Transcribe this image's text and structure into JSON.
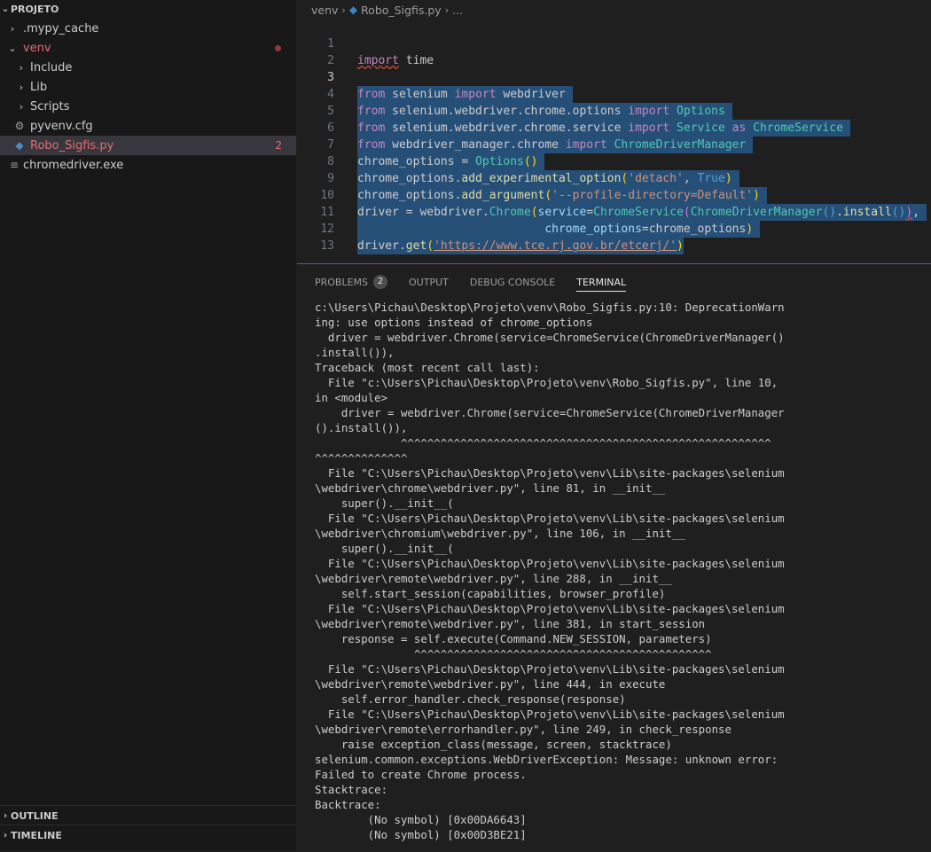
{
  "explorer": {
    "title": "PROJETO",
    "items": [
      {
        "label": ".mypy_cache"
      },
      {
        "label": "venv"
      },
      {
        "label": "Include"
      },
      {
        "label": "Lib"
      },
      {
        "label": "Scripts"
      },
      {
        "label": "pyvenv.cfg"
      },
      {
        "label": "Robo_Sigfis.py",
        "badge": "2"
      },
      {
        "label": "chromedriver.exe"
      }
    ],
    "outline_label": "OUTLINE",
    "timeline_label": "TIMELINE"
  },
  "editor": {
    "breadcrumb": [
      "venv",
      "Robo_Sigfis.py",
      "..."
    ],
    "line_numbers": [
      "1",
      "2",
      "3",
      "4",
      "5",
      "6",
      "7",
      "8",
      "9",
      "10",
      "11",
      "12",
      "13"
    ],
    "code": {
      "l1": [
        "import",
        "time"
      ],
      "l3": [
        "from",
        "selenium",
        "import",
        "webdriver"
      ],
      "l4": [
        "from",
        "selenium.webdriver.chrome.options",
        "import",
        "Options"
      ],
      "l5": [
        "from",
        "selenium.webdriver.chrome.service",
        "import",
        "Service",
        "as",
        "ChromeService"
      ],
      "l6": [
        "from",
        "webdriver_manager.chrome",
        "import",
        "ChromeDriverManager"
      ],
      "l7": [
        "chrome_options",
        "=",
        "Options",
        "()"
      ],
      "l8": [
        "chrome_options.",
        "add_experimental_option",
        "(",
        "'detach'",
        ", ",
        "True",
        ")"
      ],
      "l9": [
        "chrome_options.",
        "add_argument",
        "(",
        "'--profile-directory=Default'",
        ")"
      ],
      "l10": [
        "driver",
        "=",
        "webdriver.",
        "Chrome",
        "(",
        "service",
        "=",
        "ChromeService",
        "(",
        "ChromeDriverManager",
        "()",
        ".install",
        "()",
        ")",
        ","
      ],
      "l11": [
        "chrome_options",
        "=",
        "chrome_options",
        ")"
      ],
      "l12": [
        "driver.",
        "get",
        "(",
        "'https://www.tce.rj.gov.br/etcerj/'",
        ")"
      ]
    }
  },
  "panel": {
    "tabs": [
      {
        "label": "PROBLEMS",
        "count": "2"
      },
      {
        "label": "OUTPUT"
      },
      {
        "label": "DEBUG CONSOLE"
      },
      {
        "label": "TERMINAL"
      }
    ],
    "terminal_lines": [
      "c:\\Users\\Pichau\\Desktop\\Projeto\\venv\\Robo_Sigfis.py:10: DeprecationWarn",
      "ing: use options instead of chrome_options",
      "  driver = webdriver.Chrome(service=ChromeService(ChromeDriverManager()",
      ".install()),",
      "Traceback (most recent call last):",
      "  File \"c:\\Users\\Pichau\\Desktop\\Projeto\\venv\\Robo_Sigfis.py\", line 10,",
      "in <module>",
      "    driver = webdriver.Chrome(service=ChromeService(ChromeDriverManager",
      "().install()),",
      "             ^^^^^^^^^^^^^^^^^^^^^^^^^^^^^^^^^^^^^^^^^^^^^^^^^^^^^^^^",
      "^^^^^^^^^^^^^^",
      "  File \"C:\\Users\\Pichau\\Desktop\\Projeto\\venv\\Lib\\site-packages\\selenium",
      "\\webdriver\\chrome\\webdriver.py\", line 81, in __init__",
      "    super().__init__(",
      "  File \"C:\\Users\\Pichau\\Desktop\\Projeto\\venv\\Lib\\site-packages\\selenium",
      "\\webdriver\\chromium\\webdriver.py\", line 106, in __init__",
      "    super().__init__(",
      "  File \"C:\\Users\\Pichau\\Desktop\\Projeto\\venv\\Lib\\site-packages\\selenium",
      "\\webdriver\\remote\\webdriver.py\", line 288, in __init__",
      "    self.start_session(capabilities, browser_profile)",
      "  File \"C:\\Users\\Pichau\\Desktop\\Projeto\\venv\\Lib\\site-packages\\selenium",
      "\\webdriver\\remote\\webdriver.py\", line 381, in start_session",
      "    response = self.execute(Command.NEW_SESSION, parameters)",
      "               ^^^^^^^^^^^^^^^^^^^^^^^^^^^^^^^^^^^^^^^^^^^^^",
      "  File \"C:\\Users\\Pichau\\Desktop\\Projeto\\venv\\Lib\\site-packages\\selenium",
      "\\webdriver\\remote\\webdriver.py\", line 444, in execute",
      "    self.error_handler.check_response(response)",
      "  File \"C:\\Users\\Pichau\\Desktop\\Projeto\\venv\\Lib\\site-packages\\selenium",
      "\\webdriver\\remote\\errorhandler.py\", line 249, in check_response",
      "    raise exception_class(message, screen, stacktrace)",
      "selenium.common.exceptions.WebDriverException: Message: unknown error:",
      "Failed to create Chrome process.",
      "Stacktrace:",
      "Backtrace:",
      "        (No symbol) [0x00DA6643]",
      "        (No symbol) [0x00D3BE21]"
    ]
  },
  "colors": {
    "sidebar_bg": "#181818",
    "editor_bg": "#1f1f1f",
    "selection": "#264f78",
    "error_red": "#e06c75",
    "panel_border": "#7a4d8a"
  },
  "icons": [
    "chevron-down-icon",
    "chevron-right-icon",
    "gear-icon",
    "python-file-icon",
    "file-lines-icon"
  ]
}
